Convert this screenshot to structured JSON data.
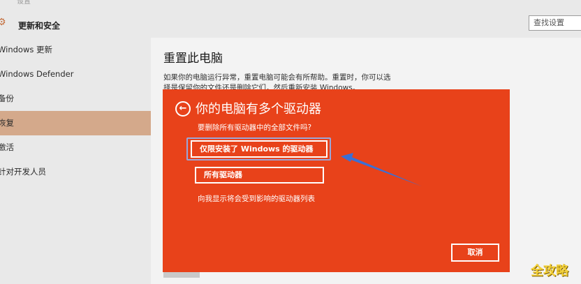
{
  "window": {
    "title": "设置"
  },
  "header": {
    "title": "更新和安全",
    "search_placeholder": "查找设置",
    "gear_icon": "gear-icon"
  },
  "sidebar": {
    "items": [
      {
        "label": "Windows 更新",
        "active": false
      },
      {
        "label": "Windows Defender",
        "active": false
      },
      {
        "label": "备份",
        "active": false
      },
      {
        "label": "恢复",
        "active": true
      },
      {
        "label": "激活",
        "active": false
      },
      {
        "label": "针对开发人员",
        "active": false
      }
    ]
  },
  "main": {
    "title": "重置此电脑",
    "description": "如果你的电脑运行异常，重置电脑可能会有所帮助。重置时，你可以选择是保留你的文件还是删除它们，然后重新安装 Windows。"
  },
  "dialog": {
    "title": "你的电脑有多个驱动器",
    "question": "要删除所有驱动器中的全部文件吗?",
    "option_installed_drive": "仅限安装了 Windows 的驱动器",
    "option_all_drives": "所有驱动器",
    "show_affected_link": "向我显示将会受到影响的驱动器列表",
    "cancel_label": "取消",
    "background_color": "#e8421a",
    "back_icon": "back-arrow-icon"
  },
  "colors": {
    "accent_active": "#d4a98b",
    "annotation": "#3b6fd4"
  },
  "watermark": {
    "text": "全攻略"
  }
}
